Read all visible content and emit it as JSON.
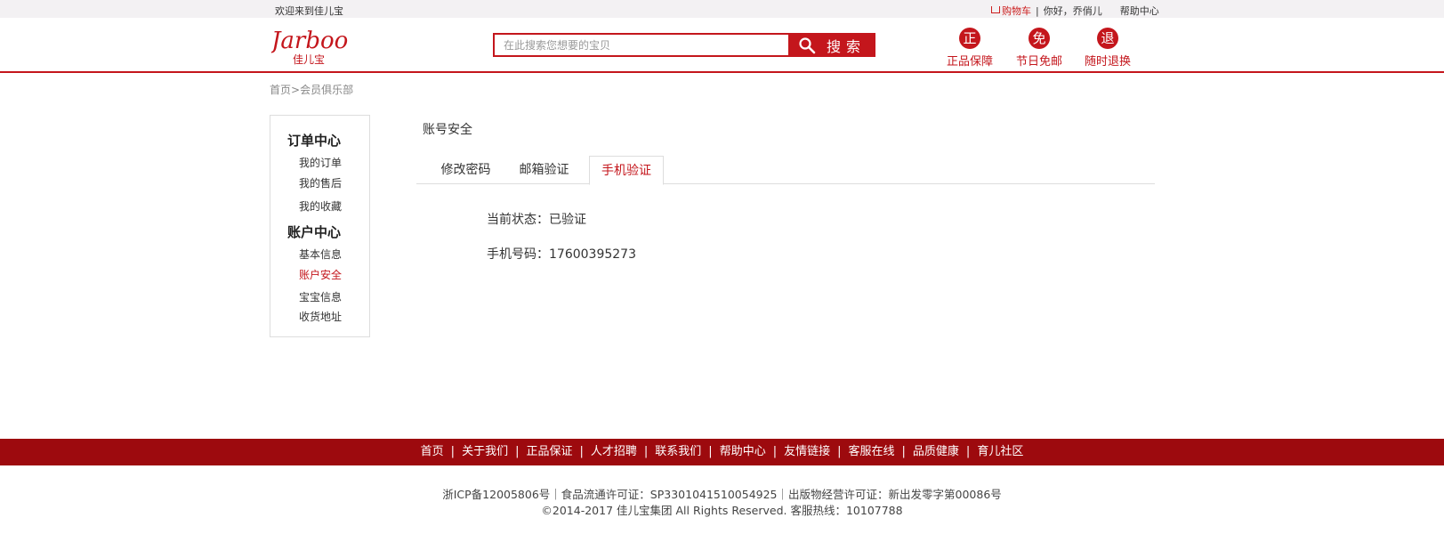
{
  "topbar": {
    "welcome": "欢迎来到佳儿宝",
    "cart": "购物车",
    "greeting": "你好，乔俏儿",
    "help": "帮助中心"
  },
  "header": {
    "logo_text": "Jarboo",
    "logo_sub": "佳儿宝",
    "search_placeholder": "在此搜索您想要的宝贝",
    "search_button": "搜索",
    "promises": [
      {
        "icon": "正",
        "label": "正品保障"
      },
      {
        "icon": "免",
        "label": "节日免邮"
      },
      {
        "icon": "退",
        "label": "随时退换"
      }
    ]
  },
  "breadcrumb": {
    "home": "首页",
    "separator": ">",
    "current": "会员俱乐部"
  },
  "sidebar": {
    "groups": [
      {
        "title": "订单中心",
        "items": [
          "我的订单",
          "我的售后",
          "我的收藏"
        ]
      },
      {
        "title": "账户中心",
        "items": [
          "基本信息",
          "账户安全",
          "宝宝信息",
          "收货地址"
        ]
      }
    ],
    "active_item": "账户安全"
  },
  "main": {
    "title": "账号安全",
    "tabs": [
      "修改密码",
      "邮箱验证",
      "手机验证"
    ],
    "active_tab": "手机验证",
    "status_label": "当前状态：已验证",
    "phone_label": "手机号码：17600395273"
  },
  "footer": {
    "links": [
      "首页",
      "关于我们",
      "正品保证",
      "人才招聘",
      "联系我们",
      "帮助中心",
      "友情链接",
      "客服在线",
      "品质健康",
      "育儿社区"
    ],
    "license": "浙ICP备12005806号｜食品流通许可证：SP3301041510054925｜出版物经营许可证：新出发零字第00086号",
    "copyright": "©2014-2017 佳儿宝集团 All Rights Reserved. 客服热线：10107788"
  },
  "colors": {
    "brand_red": "#c4161c",
    "footer_red": "#9d0a0e"
  }
}
